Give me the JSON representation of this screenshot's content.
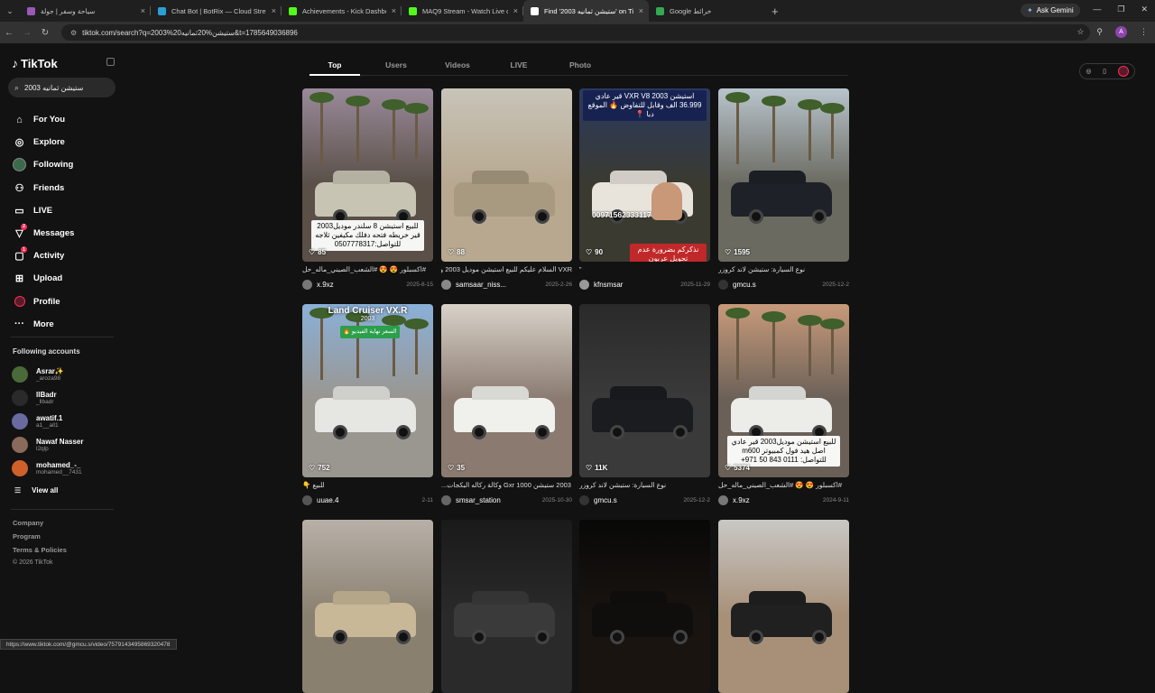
{
  "browser": {
    "tabs": [
      {
        "title": "سياحة وسفر | جولة",
        "icon_color": "#9b59b6"
      },
      {
        "title": "Chat Bot | BotRix — Cloud Stre",
        "icon_color": "#2a9fd6"
      },
      {
        "title": "Achievements - Kick Dashboard",
        "icon_color": "#53fc18"
      },
      {
        "title": "MAQ9 Stream - Watch Live on",
        "icon_color": "#53fc18"
      },
      {
        "title": "Find '2003 ستيشن ثمانيه' on TikT",
        "icon_color": "#ffffff",
        "active": true
      },
      {
        "title": "Google خرائط",
        "icon_color": "#34a853"
      }
    ],
    "new_tab": "+",
    "ask_gemini": "Ask Gemini",
    "url": "tiktok.com/search?q=2003%20ستيشن%20ثمانيه&t=1785649036896",
    "profile_initial": "A",
    "status_url": "https://www.tiktok.com/@gmcu.s/video/7579143495869320478"
  },
  "sidebar": {
    "logo": "TikTok",
    "search_value": "2003 ستيشن ثمانيه",
    "menu": [
      {
        "label": "For You",
        "icon": "home-icon",
        "glyph": "⌂"
      },
      {
        "label": "Explore",
        "icon": "compass-icon",
        "glyph": "◎"
      },
      {
        "label": "Following",
        "icon": "following-avatar",
        "glyph": ""
      },
      {
        "label": "Friends",
        "icon": "friends-icon",
        "glyph": "⚇"
      },
      {
        "label": "LIVE",
        "icon": "live-icon",
        "glyph": "▭"
      },
      {
        "label": "Messages",
        "icon": "messages-icon",
        "glyph": "▽",
        "badge": "2"
      },
      {
        "label": "Activity",
        "icon": "activity-icon",
        "glyph": "▢",
        "badge": "1"
      },
      {
        "label": "Upload",
        "icon": "upload-icon",
        "glyph": "⊞"
      },
      {
        "label": "Profile",
        "icon": "profile-avatar",
        "glyph": ""
      },
      {
        "label": "More",
        "icon": "more-icon",
        "glyph": "···"
      }
    ],
    "following_title": "Following accounts",
    "following": [
      {
        "name": "Asrar✨",
        "handle": "_aroza98",
        "color": "#4a6a3a"
      },
      {
        "name": "llBadr",
        "handle": "_llbadr",
        "color": "#2a2a2a"
      },
      {
        "name": "awatif.1",
        "handle": "a1__all1",
        "color": "#6a6aa0"
      },
      {
        "name": "Nawaf Nasser",
        "handle": "l2qlp",
        "color": "#8a6a5a"
      },
      {
        "name": "mohamed_-_",
        "handle": "mohamed__7431",
        "color": "#d0602a"
      }
    ],
    "view_all": "View all",
    "footer": [
      "Company",
      "Program",
      "Terms & Policies",
      "© 2026 TikTok"
    ]
  },
  "search_tabs": [
    "Top",
    "Users",
    "Videos",
    "LIVE",
    "Photo"
  ],
  "results": [
    {
      "likes": "85",
      "desc": "#اكسبلور 😍 😍 #الشعب_الصيني_ماله_حل",
      "user": "x.9xz",
      "date": "2025-8-15",
      "overlay": "للبيع استيشن 8 سلندر موديل2003 قير خريطه فتحه دفلك مكيفين ثلاجه للتواصل:0507778317",
      "sky": "#9a8a9a",
      "ground": "#5a5048",
      "car": "#c8c4b4",
      "avc": "#777"
    },
    {
      "likes": "88",
      "desc": "VXR السلام عليكم للبيع استيشن موديل 2003 وارد",
      "user": "samsaar_niss...",
      "date": "2025-2-26",
      "overlay": "",
      "sky": "#c8c4b8",
      "ground": "#b8a890",
      "car": "#a89a80",
      "avc": "#888"
    },
    {
      "likes": "90",
      "desc": "”",
      "user": "kfnsmsar",
      "date": "2025-11-29",
      "overlay_top": "استيشن VXR V8 2003 قير عادي 36.999 الف وقابل للتفاوض 🔥 الموقع دبا 📍",
      "overlay_bottom": "نذكركم بضرورة عدم تحويل عربون",
      "phone": "00971562333117",
      "sky": "#2a3a60",
      "ground": "#3a3a30",
      "car": "#e8e4dc",
      "avc": "#999"
    },
    {
      "likes": "1595",
      "desc": "نوع السيارة: ستيشن لاند كروزر",
      "user": "gmcu.s",
      "date": "2025-12-2",
      "overlay": "",
      "sky": "#b8c4cc",
      "ground": "#6a6a60",
      "car": "#1e2228",
      "avc": "#333"
    },
    {
      "likes": "752",
      "desc": "للبيع 👇",
      "user": "uuae.4",
      "date": "2-11",
      "overlay_title": "Land Cruiser VX.R",
      "overlay_sub": "2003",
      "overlay_tag": "السعر نهاية الفيديو 🔥",
      "sky": "#8ab0d8",
      "ground": "#9a9690",
      "car": "#e6e6e2",
      "avc": "#555"
    },
    {
      "likes": "35",
      "desc": "2003 ستيشن Gxr 1000 وكالة ركاله البكجات...",
      "user": "smsar_station",
      "date": "2025-10-30",
      "overlay": "",
      "sky": "#d8d2c8",
      "ground": "#8a7a70",
      "car": "#f0f0ec",
      "avc": "#666"
    },
    {
      "likes": "11K",
      "desc": "نوع السيارة: ستيشن لاند كروزر",
      "user": "gmcu.s",
      "date": "2025-12-2",
      "overlay": "",
      "sky": "#2a2a2a",
      "ground": "#3a3a3a",
      "car": "#1a1c20",
      "avc": "#333"
    },
    {
      "likes": "5374",
      "desc": "#اكسبلور 😍 😍 #الشعب_الصيني_ماله_حل",
      "user": "x.9xz",
      "date": "2024-9-11",
      "overlay": "للبيع استيشن موديل2003 قير عادي اصل هيد فول كمبيوتر m600 للتواصل: 0111 843 50 971+",
      "sky": "#c89a7a",
      "ground": "#6a6058",
      "car": "#ecece8",
      "avc": "#777"
    },
    {
      "likes": "",
      "desc": "",
      "user": "",
      "date": "",
      "overlay": "",
      "sky": "#b8b0a8",
      "ground": "#8a8070",
      "car": "#c8b898",
      "avc": "#777"
    },
    {
      "likes": "",
      "desc": "",
      "user": "",
      "date": "",
      "overlay": "",
      "sky": "#1a1a1a",
      "ground": "#2a2a2a",
      "car": "#3a3a3a",
      "avc": "#777"
    },
    {
      "likes": "",
      "desc": "",
      "user": "",
      "date": "",
      "overlay": "",
      "sky": "#080808",
      "ground": "#1a1410",
      "car": "#100e0c",
      "avc": "#777"
    },
    {
      "likes": "",
      "desc": "",
      "user": "",
      "date": "",
      "overlay": "",
      "sky": "#c8c8c4",
      "ground": "#a89078",
      "car": "#202020",
      "avc": "#777"
    }
  ]
}
